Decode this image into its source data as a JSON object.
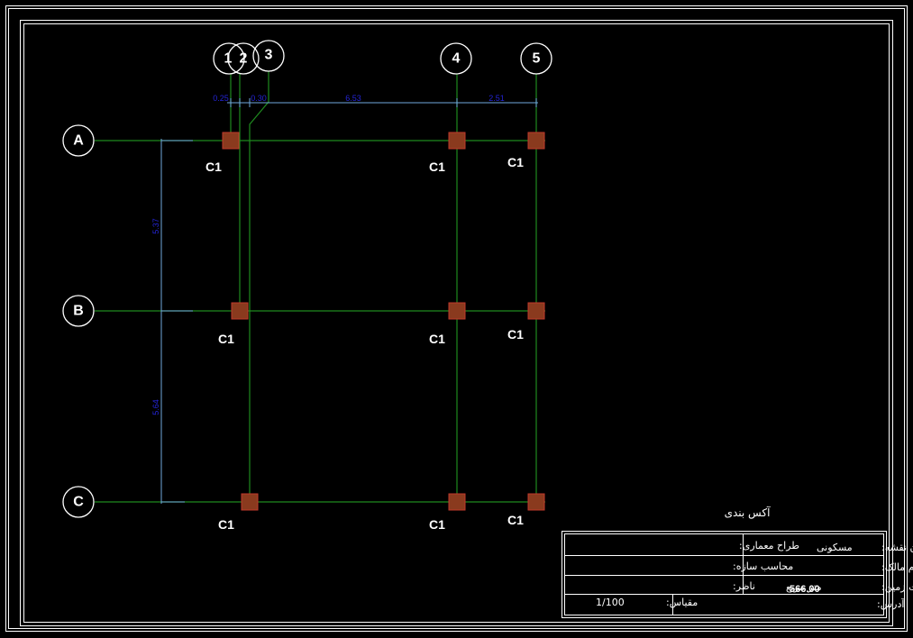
{
  "drawing": {
    "title": "آکس بندی",
    "vertical_axes": [
      "1",
      "2",
      "3",
      "4",
      "5"
    ],
    "horizontal_axes": [
      "A",
      "B",
      "C"
    ],
    "column_label": "C1",
    "dimensions_top": [
      "0.25",
      "0.30",
      "6.53",
      "2.51"
    ],
    "dimensions_left": [
      "5.37",
      "5.64"
    ],
    "colors": {
      "background": "#000000",
      "axis_line": "#1f8a1f",
      "dimension_line": "#6fa8dc",
      "dimension_text": "#2424d6",
      "column_fill": "#8a3a1e",
      "column_border": "#c0392b",
      "frame": "#ffffff"
    }
  },
  "title_block": {
    "architect_label": "طراح معماری:",
    "structural_label": "محاسب سازه:",
    "supervisor_label": "ناظر:",
    "scale_label": "مقیاس:",
    "scale_value": "1/100",
    "plan_title_label": "عنوان نقشه:",
    "plan_title_value": "مسکونی",
    "owner_label": "نام مالک:",
    "area_label": "مساحت زمین:",
    "area_value": "566.00",
    "area_unit": "متر مربع",
    "address_label": "آدرس:"
  }
}
